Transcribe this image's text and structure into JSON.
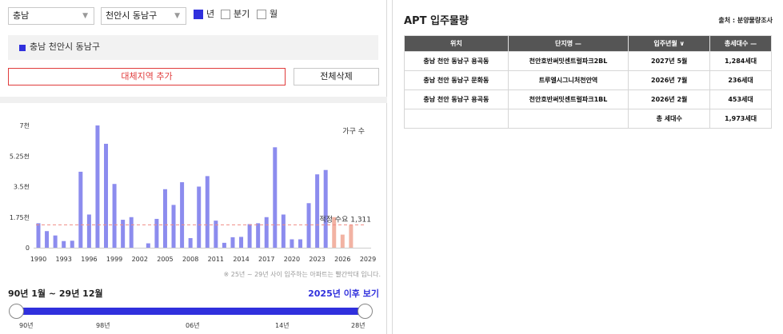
{
  "filters": {
    "sido": "충남",
    "sigungu": "천안시 동남구",
    "periods": [
      {
        "label": "년",
        "checked": true
      },
      {
        "label": "분기",
        "checked": false
      },
      {
        "label": "월",
        "checked": false
      }
    ]
  },
  "region_tag": "충남 천안시 동남구",
  "buttons": {
    "add": "대체지역 추가",
    "clear": "전체삭제"
  },
  "chart_data": {
    "type": "bar",
    "title": "",
    "xlabel": "",
    "ylabel": "",
    "series_label": "가구 수",
    "x_tick_labels": [
      "1990",
      "1993",
      "1996",
      "1999",
      "2002",
      "2005",
      "2008",
      "2011",
      "2014",
      "2017",
      "2020",
      "2023",
      "2026",
      "2029"
    ],
    "y_tick_labels": [
      "0",
      "1.75천",
      "3.5천",
      "5.25천",
      "7천"
    ],
    "ylim": [
      0,
      7000
    ],
    "categories": [
      1990,
      1991,
      1992,
      1993,
      1994,
      1995,
      1996,
      1997,
      1998,
      1999,
      2000,
      2001,
      2002,
      2003,
      2004,
      2005,
      2006,
      2007,
      2008,
      2009,
      2010,
      2011,
      2012,
      2013,
      2014,
      2015,
      2016,
      2017,
      2018,
      2019,
      2020,
      2021,
      2022,
      2023,
      2024,
      2025,
      2026,
      2027
    ],
    "values": [
      1400,
      950,
      700,
      380,
      400,
      4350,
      1900,
      7000,
      5950,
      3650,
      1600,
      1750,
      0,
      250,
      1650,
      3350,
      2450,
      3750,
      550,
      3500,
      4100,
      1550,
      280,
      600,
      620,
      1350,
      1400,
      1750,
      5750,
      1900,
      480,
      480,
      2550,
      4200,
      4450,
      1750,
      750,
      1300
    ],
    "future_from": 2025,
    "colors": {
      "past": "#8c8cee",
      "future": "#f2b3a3",
      "reference": "#f08c84"
    },
    "reference_line": {
      "label": "적정 수요",
      "value": 1311,
      "value_text": "1,311"
    },
    "grid": false,
    "legend": "none"
  },
  "note": "※ 25년 ~ 29년 사이 입주하는 아파트는 빨간막대 입니다.",
  "range": {
    "period_text": "90년 1월 ~ 29년 12월",
    "after_link": "2025년 이후 보기",
    "scale_labels": [
      "90년",
      "98년",
      "06년",
      "14년",
      "28년"
    ]
  },
  "apt": {
    "title": "APT 입주물량",
    "source": "출처 : 분양물량조사",
    "headers": [
      "위치",
      "단지명 —",
      "입주년월 ∨",
      "총세대수 —"
    ],
    "rows": [
      [
        "충남 천안 동남구 용곡동",
        "천안호반써밋센트럴파크2BL",
        "2027년 5월",
        "1,284세대"
      ],
      [
        "충남 천안 동남구 문화동",
        "트루엘시그니처천안역",
        "2026년 7월",
        "236세대"
      ],
      [
        "충남 천안 동남구 용곡동",
        "천안호반써밋센트럴파크1BL",
        "2026년 2월",
        "453세대"
      ]
    ],
    "total_label": "총 세대수",
    "total_value": "1,973세대"
  }
}
